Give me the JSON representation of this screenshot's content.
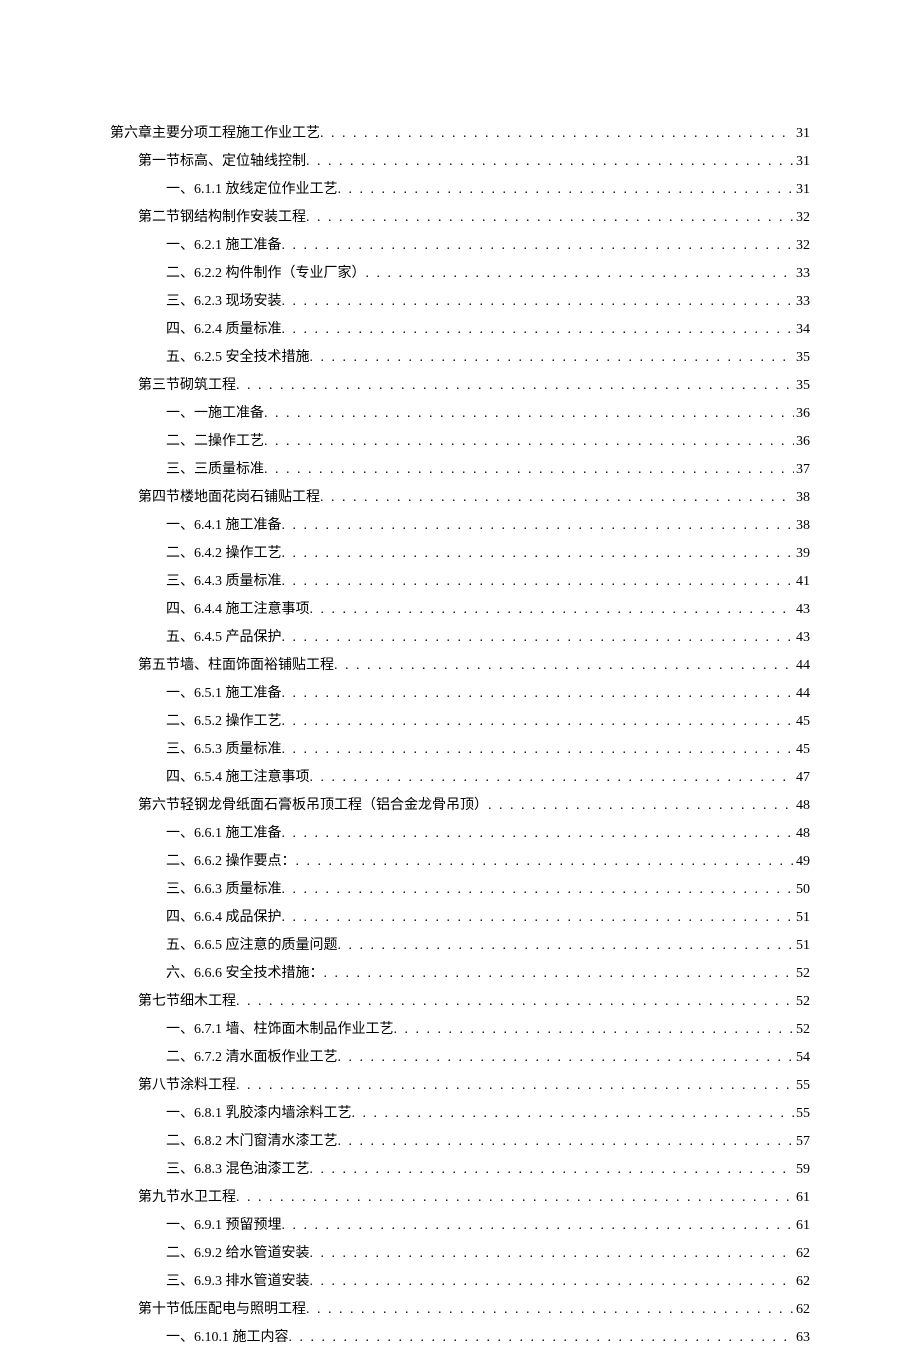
{
  "toc": [
    {
      "level": 0,
      "title": "第六章主要分项工程施工作业工艺",
      "page": "31"
    },
    {
      "level": 1,
      "title": "第一节标高、定位轴线控制",
      "page": "31"
    },
    {
      "level": 2,
      "title": "一、6.1.1 放线定位作业工艺",
      "page": "31"
    },
    {
      "level": 1,
      "title": "第二节钢结构制作安装工程",
      "page": "32"
    },
    {
      "level": 2,
      "title": "一、6.2.1 施工准备",
      "page": "32"
    },
    {
      "level": 2,
      "title": "二、6.2.2 构件制作（专业厂家）",
      "page": "33"
    },
    {
      "level": 2,
      "title": "三、6.2.3 现场安装",
      "page": "33"
    },
    {
      "level": 2,
      "title": "四、6.2.4 质量标准",
      "page": "34"
    },
    {
      "level": 2,
      "title": "五、6.2.5 安全技术措施",
      "page": "35"
    },
    {
      "level": 1,
      "title": "第三节砌筑工程",
      "page": "35"
    },
    {
      "level": 2,
      "title": "一、一施工准备",
      "page": "36"
    },
    {
      "level": 2,
      "title": "二、二操作工艺",
      "page": "36"
    },
    {
      "level": 2,
      "title": "三、三质量标准",
      "page": "37"
    },
    {
      "level": 1,
      "title": "第四节楼地面花岗石铺贴工程",
      "page": "38"
    },
    {
      "level": 2,
      "title": "一、6.4.1 施工准备",
      "page": "38"
    },
    {
      "level": 2,
      "title": "二、6.4.2 操作工艺",
      "page": "39"
    },
    {
      "level": 2,
      "title": "三、6.4.3 质量标准",
      "page": "41"
    },
    {
      "level": 2,
      "title": "四、6.4.4 施工注意事项",
      "page": "43"
    },
    {
      "level": 2,
      "title": "五、6.4.5 产品保护",
      "page": "43"
    },
    {
      "level": 1,
      "title": "第五节墙、柱面饰面裕铺贴工程",
      "page": "44"
    },
    {
      "level": 2,
      "title": "一、6.5.1 施工准备",
      "page": "44"
    },
    {
      "level": 2,
      "title": "二、6.5.2 操作工艺",
      "page": "45"
    },
    {
      "level": 2,
      "title": "三、6.5.3 质量标准",
      "page": "45"
    },
    {
      "level": 2,
      "title": "四、6.5.4 施工注意事项",
      "page": "47"
    },
    {
      "level": 1,
      "title": "第六节轻钢龙骨纸面石膏板吊顶工程（铝合金龙骨吊顶）",
      "page": "48"
    },
    {
      "level": 2,
      "title": "一、6.6.1 施工准备",
      "page": "48"
    },
    {
      "level": 2,
      "title": "二、6.6.2 操作要点：",
      "page": "49"
    },
    {
      "level": 2,
      "title": "三、6.6.3 质量标准",
      "page": "50"
    },
    {
      "level": 2,
      "title": "四、6.6.4 成品保护",
      "page": "51"
    },
    {
      "level": 2,
      "title": "五、6.6.5 应注意的质量问题",
      "page": "51"
    },
    {
      "level": 2,
      "title": "六、6.6.6 安全技术措施：",
      "page": "52"
    },
    {
      "level": 1,
      "title": "第七节细木工程",
      "page": "52"
    },
    {
      "level": 2,
      "title": "一、6.7.1 墙、柱饰面木制品作业工艺",
      "page": "52"
    },
    {
      "level": 2,
      "title": "二、6.7.2 清水面板作业工艺",
      "page": "54"
    },
    {
      "level": 1,
      "title": "第八节涂料工程",
      "page": "55"
    },
    {
      "level": 2,
      "title": "一、6.8.1 乳胶漆内墙涂料工艺",
      "page": "55"
    },
    {
      "level": 2,
      "title": "二、6.8.2 木门窗清水漆工艺",
      "page": "57"
    },
    {
      "level": 2,
      "title": "三、6.8.3 混色油漆工艺",
      "page": "59"
    },
    {
      "level": 1,
      "title": "第九节水卫工程",
      "page": "61"
    },
    {
      "level": 2,
      "title": "一、6.9.1 预留预埋",
      "page": "61"
    },
    {
      "level": 2,
      "title": "二、6.9.2 给水管道安装",
      "page": "62"
    },
    {
      "level": 2,
      "title": "三、6.9.3 排水管道安装",
      "page": "62"
    },
    {
      "level": 1,
      "title": "第十节低压配电与照明工程",
      "page": "62"
    },
    {
      "level": 2,
      "title": "一、6.10.1 施工内容",
      "page": "63"
    }
  ]
}
